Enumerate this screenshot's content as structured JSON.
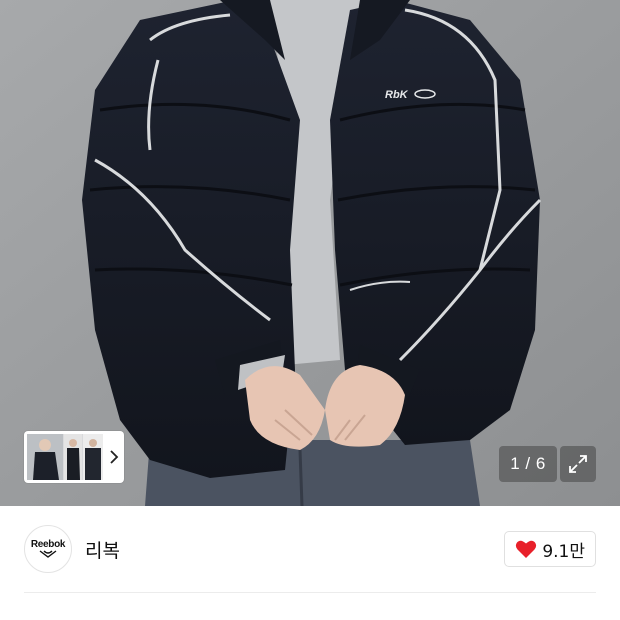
{
  "gallery": {
    "counter_current": "1",
    "counter_separator": " / ",
    "counter_total": "6",
    "jacket_logo": "RbK",
    "thumbnail_count": 3
  },
  "brand": {
    "logo_text": "Reebok",
    "name": "리복"
  },
  "like": {
    "count": "9.1만",
    "icon": "heart-icon",
    "color": "#e8202a"
  }
}
